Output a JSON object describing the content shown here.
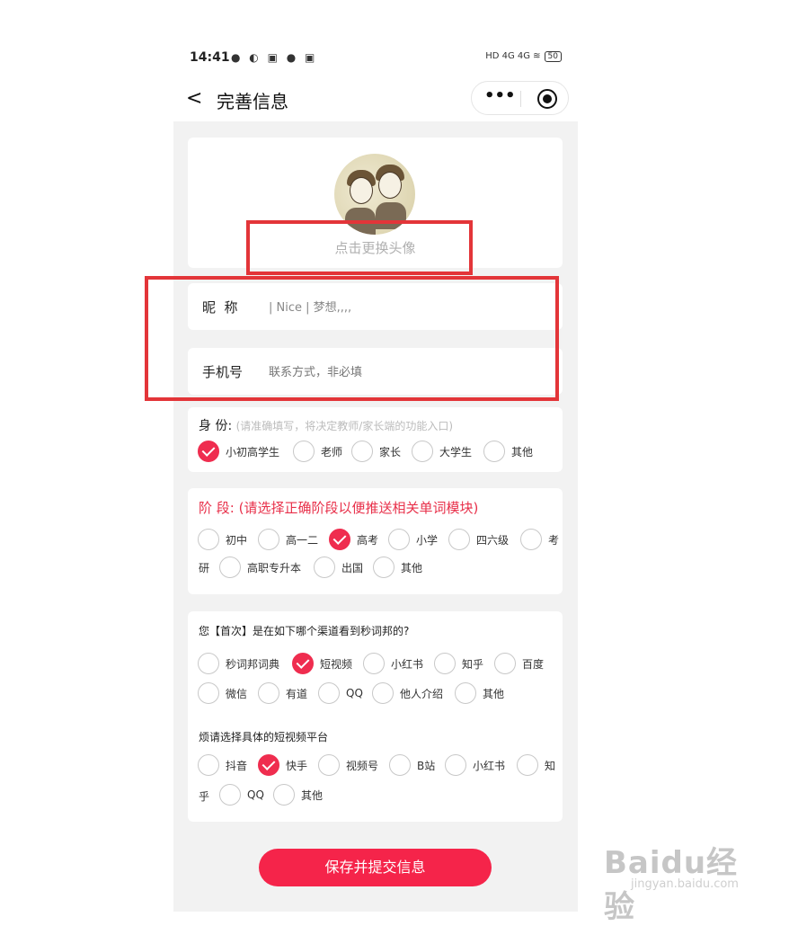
{
  "status_bar": {
    "time": "14:41",
    "battery": "50"
  },
  "nav": {
    "title": "完善信息",
    "back": "<"
  },
  "avatar": {
    "tip": "点击更换头像"
  },
  "nickname": {
    "label": "昵  称",
    "placeholder": "| Nice | 梦想,,,,"
  },
  "phone": {
    "label": "手机号",
    "placeholder": "联系方式，非必填"
  },
  "identity": {
    "label": "身 份:",
    "hint": "(请准确填写，将决定教师/家长端的功能入口)",
    "options": [
      "小初高学生",
      "老师",
      "家长",
      "大学生",
      "其他"
    ],
    "selected": "小初高学生"
  },
  "stage": {
    "label": "阶 段: (请选择正确阶段以便推送相关单词模块)",
    "options": [
      "初中",
      "高一二",
      "高考",
      "小学",
      "四六级",
      "考",
      "研",
      "高职专升本",
      "出国",
      "其他"
    ],
    "selected": "高考"
  },
  "channel": {
    "question": "您【首次】是在如下哪个渠道看到秒词邦的?",
    "options": [
      "秒词邦词典",
      "短视频",
      "小红书",
      "知乎",
      "百度",
      "微信",
      "有道",
      "QQ",
      "他人介绍",
      "其他"
    ],
    "selected": "短视频"
  },
  "platform": {
    "question": "烦请选择具体的短视频平台",
    "options": [
      "抖音",
      "快手",
      "视频号",
      "B站",
      "小红书",
      "知",
      "乎",
      "QQ",
      "其他"
    ],
    "selected": "快手"
  },
  "submit_label": "保存并提交信息",
  "watermark": {
    "logo": "Baidu经验",
    "sub": "jingyan.baidu.com"
  },
  "colors": {
    "accent": "#f5244a",
    "highlight_box": "#e33539"
  }
}
